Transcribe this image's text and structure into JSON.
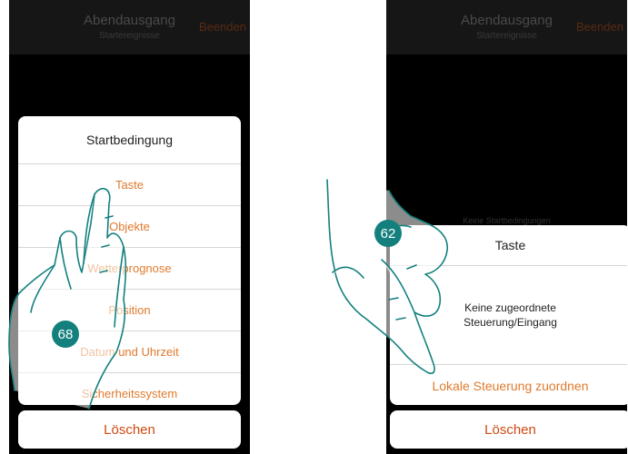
{
  "left": {
    "header": {
      "title": "Abendausgang",
      "subtitle": "Startereignisse",
      "end_label": "Beenden"
    },
    "sheet": {
      "title": "Startbedingung",
      "items": [
        {
          "label": "Taste"
        },
        {
          "label": "Objekte"
        },
        {
          "label": "Wetterprognose"
        },
        {
          "label": "Position"
        },
        {
          "label": "Datum und Uhrzeit"
        },
        {
          "label": "Sicherheitssystem"
        }
      ]
    },
    "delete_label": "Löschen",
    "step_badge": "68"
  },
  "right": {
    "header": {
      "title": "Abendausgang",
      "subtitle": "Startereignisse",
      "end_label": "Beenden"
    },
    "behind_text": "Keine Startbedingungen",
    "sheet": {
      "title": "Taste",
      "message": "Keine zugeordnete Steuerung/Eingang",
      "action_label": "Lokale Steuerung zuordnen"
    },
    "delete_label": "Löschen",
    "step_badge": "62"
  },
  "colors": {
    "accent": "#e07a2c",
    "delete": "#d04a12",
    "badge": "#13807e",
    "hand_outline": "#13807e"
  },
  "icons": {
    "hand": "pointing-hand-icon"
  }
}
